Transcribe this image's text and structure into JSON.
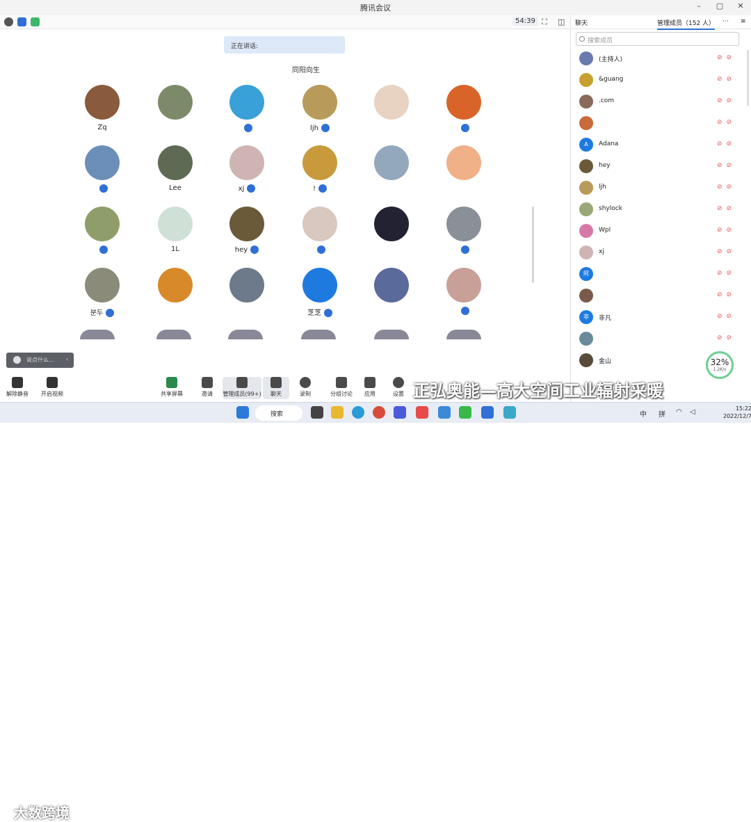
{
  "title": "腾讯会议",
  "meeting": {
    "timer": "54:39",
    "speaking_label": "正在讲话:"
  },
  "top_row_names": [
    "",
    "",
    "",
    "同阳向生",
    "",
    ""
  ],
  "tiles": [
    {
      "name": "Zq",
      "color": "#8a5a3c",
      "mic": false
    },
    {
      "name": "",
      "color": "#7d8a6a",
      "mic": false
    },
    {
      "name": "",
      "color": "#3aa0d8",
      "mic": true
    },
    {
      "name": "ljh",
      "color": "#b89a5a",
      "mic": true
    },
    {
      "name": "",
      "color": "#e8d2c2",
      "mic": false
    },
    {
      "name": "",
      "color": "#d9642a",
      "mic": true
    },
    {
      "name": "",
      "color": "#6b8fb8",
      "mic": true
    },
    {
      "name": "Lee",
      "color": "#5d6b55",
      "mic": false
    },
    {
      "name": "xj",
      "color": "#cfb4b4",
      "mic": true
    },
    {
      "name": "!",
      "color": "#c89a3c",
      "mic": true
    },
    {
      "name": "",
      "color": "#93a8bd",
      "mic": false
    },
    {
      "name": "",
      "color": "#f0b088",
      "mic": false
    },
    {
      "name": "",
      "color": "#8f9d6a",
      "mic": true
    },
    {
      "name": "1L",
      "color": "#cfe0d6",
      "mic": false
    },
    {
      "name": "hey",
      "color": "#6a5a3a",
      "mic": true
    },
    {
      "name": "",
      "color": "#d8c8c0",
      "mic": true
    },
    {
      "name": "",
      "color": "#223",
      "mic": false
    },
    {
      "name": "",
      "color": "#8a8f98",
      "mic": true
    },
    {
      "name": "분두",
      "color": "#8b8b7a",
      "mic": true
    },
    {
      "name": "",
      "color": "#d88a2a",
      "mic": false
    },
    {
      "name": "",
      "color": "#6c7a8a",
      "mic": false
    },
    {
      "name": "芝芝",
      "color": "#1f7ae0",
      "mic": true
    },
    {
      "name": "",
      "color": "#5a6a9a",
      "mic": false
    },
    {
      "name": "",
      "color": "#c8a098",
      "mic": true
    }
  ],
  "chat_placeholder": "说点什么...",
  "toolbar": {
    "mute": "解除静音",
    "video": "开启视频",
    "share": "共享屏幕",
    "invite": "邀请",
    "members": "管理成员(99+)",
    "chat": "聊天",
    "record": "录制",
    "breakout": "分组讨论",
    "apps": "应用",
    "settings": "设置"
  },
  "panel": {
    "tab_chat": "聊天",
    "tab_members": "管理成员（152 人）",
    "search_placeholder": "搜索成员",
    "members": [
      {
        "name": "(主持人)",
        "color": "#6a7ab0"
      },
      {
        "name": "&guang",
        "color": "#c8a030"
      },
      {
        "name": ".com",
        "color": "#8a6a5a"
      },
      {
        "name": "",
        "color": "#c86a3a"
      },
      {
        "name": "Adana",
        "color": "#1f7ae0",
        "initial": "A"
      },
      {
        "name": "hey",
        "color": "#6a5a3a"
      },
      {
        "name": "ljh",
        "color": "#b89a5a"
      },
      {
        "name": "shylock",
        "color": "#9aa878"
      },
      {
        "name": "Wpl",
        "color": "#d878a8"
      },
      {
        "name": "xj",
        "color": "#cfb4b4"
      },
      {
        "name": "",
        "color": "#1f7ae0",
        "initial": "阿"
      },
      {
        "name": "",
        "color": "#7a5a4a"
      },
      {
        "name": "非凡",
        "color": "#1f7ae0",
        "initial": "非"
      },
      {
        "name": "",
        "color": "#6a8a9a"
      },
      {
        "name": "金山",
        "color": "#5a4a3a"
      }
    ],
    "gauge_value": "32%",
    "gauge_rate": "1.2K/s"
  },
  "watermark": "正弘奥能—高大空间工业辐射采暖",
  "watermark2": "大数跨境",
  "taskbar": {
    "search_label": "搜索",
    "lang": "中",
    "ime": "拼",
    "time": "15:22",
    "date": "2022/12/7"
  }
}
